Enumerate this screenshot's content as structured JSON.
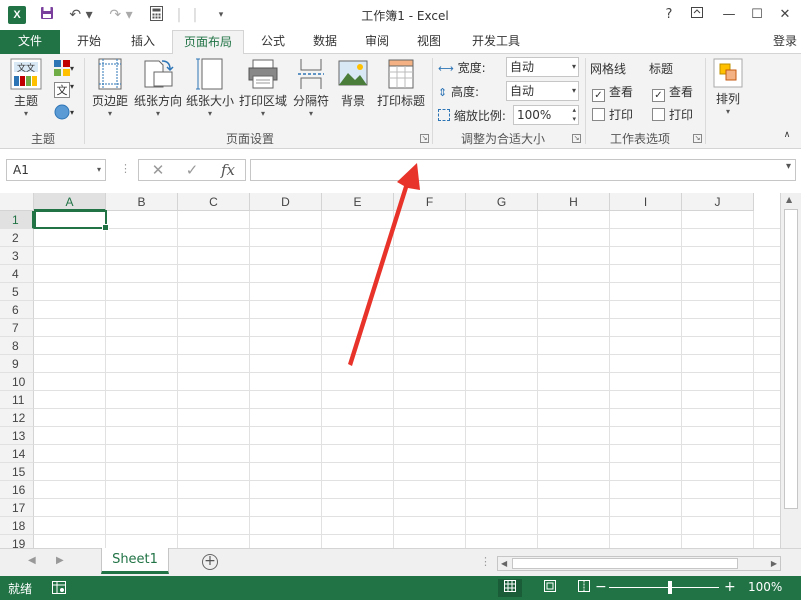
{
  "title_bar": {
    "app_icon_letter": "X",
    "title": "工作簿1 - Excel",
    "help": "?",
    "minimize": "—",
    "maximize": "☐",
    "close": "✕"
  },
  "tabs": {
    "file": "文件",
    "home": "开始",
    "insert": "插入",
    "page_layout": "页面布局",
    "formulas": "公式",
    "data": "数据",
    "review": "审阅",
    "view": "视图",
    "developer": "开发工具",
    "login": "登录"
  },
  "ribbon": {
    "themes": {
      "theme_button": "主题",
      "group_label": "主题"
    },
    "page_setup": {
      "margins": "页边距",
      "orientation": "纸张方向",
      "size": "纸张大小",
      "print_area": "打印区域",
      "breaks": "分隔符",
      "background": "背景",
      "print_titles": "打印标题",
      "group_label": "页面设置"
    },
    "scale_to_fit": {
      "width_label": "宽度:",
      "width_value": "自动",
      "height_label": "高度:",
      "height_value": "自动",
      "scale_label": "缩放比例:",
      "scale_value": "100%",
      "group_label": "调整为合适大小"
    },
    "sheet_options": {
      "gridlines_label": "网格线",
      "headings_label": "标题",
      "view_label": "查看",
      "print_label": "打印",
      "group_label": "工作表选项"
    },
    "arrange": {
      "arrange_button": "排列"
    }
  },
  "formula_bar": {
    "name_box": "A1",
    "cancel_glyph": "✕",
    "enter_glyph": "✓",
    "fx_label": "fx",
    "formula_value": ""
  },
  "grid": {
    "columns": [
      "A",
      "B",
      "C",
      "D",
      "E",
      "F",
      "G",
      "H",
      "I",
      "J"
    ],
    "rows": [
      "1",
      "2",
      "3",
      "4",
      "5",
      "6",
      "7",
      "8",
      "9",
      "10",
      "11",
      "12",
      "13",
      "14",
      "15",
      "16",
      "17",
      "18",
      "19"
    ],
    "active_cell": "A1"
  },
  "sheet_tabs": {
    "tabs": [
      "Sheet1"
    ],
    "add_glyph": "+"
  },
  "status_bar": {
    "ready": "就绪",
    "zoom_minus": "−",
    "zoom_plus": "+",
    "zoom_percent": "100%"
  },
  "colors": {
    "excel_green": "#217346",
    "annotation_red": "#e8332a"
  }
}
